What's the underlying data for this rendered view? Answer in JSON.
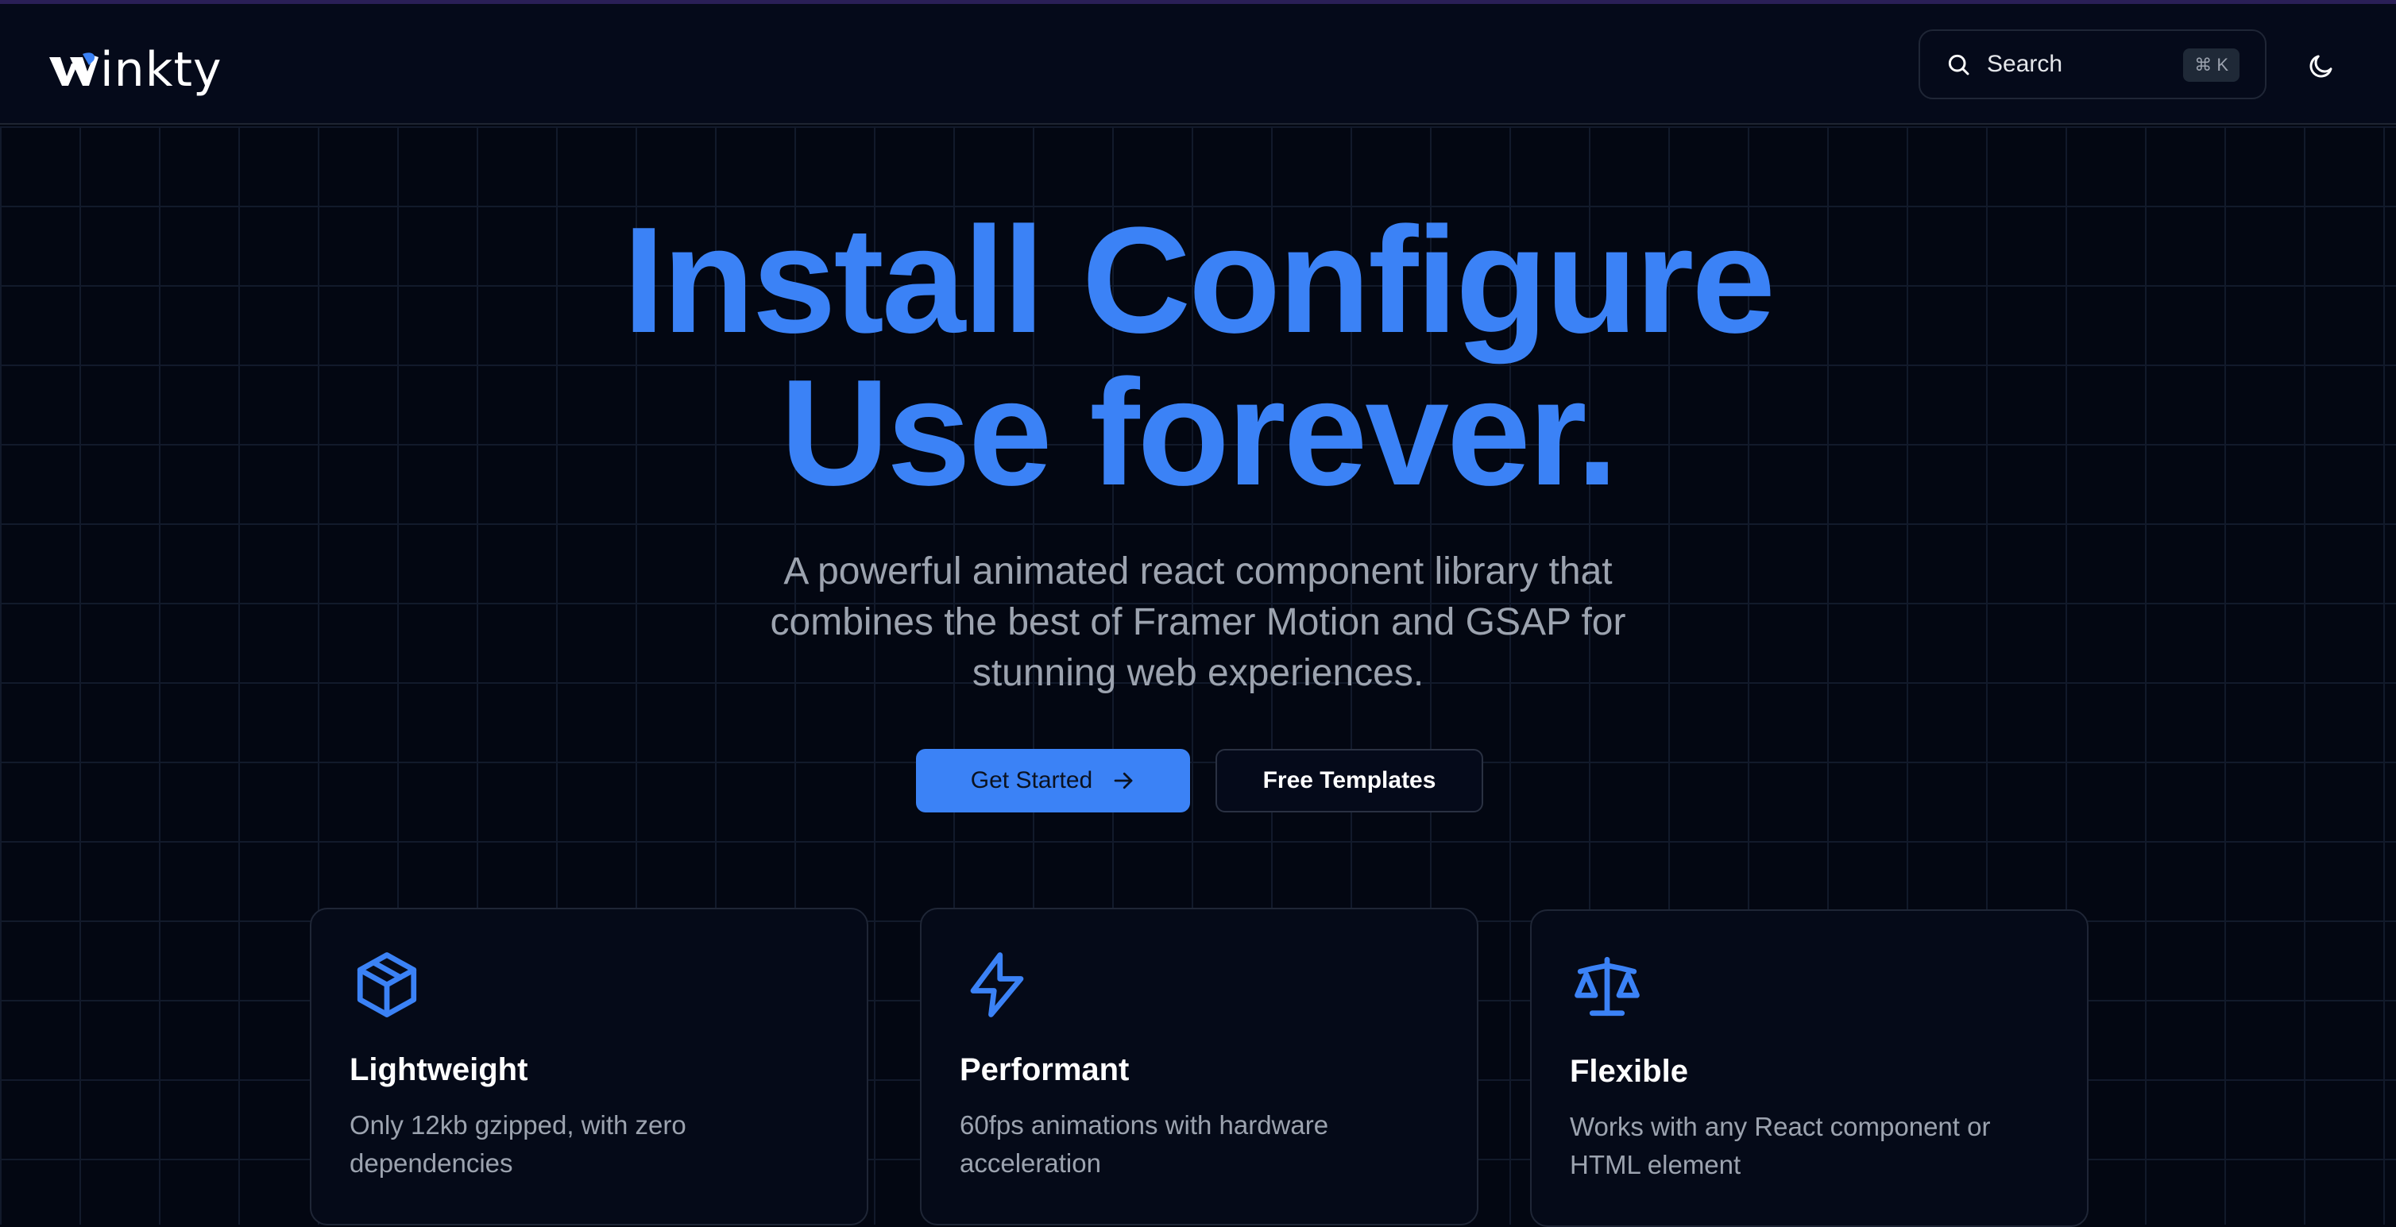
{
  "header": {
    "logo_text": "inkty",
    "search": {
      "label": "Search",
      "shortcut": "⌘ K"
    },
    "theme_toggle_icon": "moon-icon"
  },
  "hero": {
    "title_line1": "Install Configure",
    "title_line2": "Use forever.",
    "subtitle": "A powerful animated react component library that combines the best of Framer Motion and GSAP for stunning web experiences.",
    "primary_button": "Get Started",
    "secondary_button": "Free Templates"
  },
  "features": [
    {
      "icon": "package-icon",
      "title": "Lightweight",
      "description": "Only 12kb gzipped, with zero dependencies"
    },
    {
      "icon": "lightning-icon",
      "title": "Performant",
      "description": "60fps animations with hardware acceleration"
    },
    {
      "icon": "scale-icon",
      "title": "Flexible",
      "description": "Works with any React component or HTML element"
    }
  ],
  "colors": {
    "background": "#030712",
    "accent": "#3b82f6",
    "muted_text": "#9ca3af"
  }
}
